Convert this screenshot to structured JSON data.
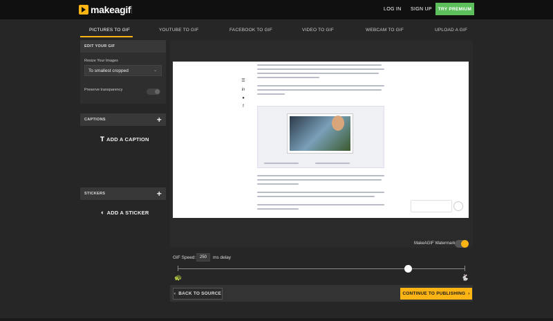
{
  "header": {
    "logo_text": "makeagif",
    "login_label": "LOG IN",
    "signup_label": "SIGN UP",
    "premium_label": "TRY PREMIUM",
    "premium_color": "#5cbf5c",
    "accent_color": "#fcb414"
  },
  "tabs": [
    {
      "label": "PICTURES TO GIF",
      "active": true
    },
    {
      "label": "YOUTUBE TO GIF",
      "active": false
    },
    {
      "label": "FACEBOOK TO GIF",
      "active": false
    },
    {
      "label": "VIDEO TO GIF",
      "active": false
    },
    {
      "label": "WEBCAM TO GIF",
      "active": false
    },
    {
      "label": "UPLOAD A GIF",
      "active": false
    }
  ],
  "edit": {
    "section_title": "EDIT YOUR GIF",
    "resize_label": "Resize Your Images",
    "resize_value": "To smallest cropped",
    "transparency_label": "Preserve transparency",
    "transparency_on": false
  },
  "captions": {
    "section_title": "CAPTIONS",
    "add_label": "ADD A CAPTION"
  },
  "stickers": {
    "section_title": "STICKERS",
    "add_label": "ADD A STICKER"
  },
  "watermark": {
    "label": "MakeAGIF Watermark",
    "enabled": true
  },
  "speed": {
    "label": "GIF Speed:",
    "value": "250",
    "unit": "ms delay",
    "slider_fraction": 0.8
  },
  "actions": {
    "back_label": "BACK TO SOURCE",
    "continue_label": "CONTINUE TO PUBLISHING"
  }
}
